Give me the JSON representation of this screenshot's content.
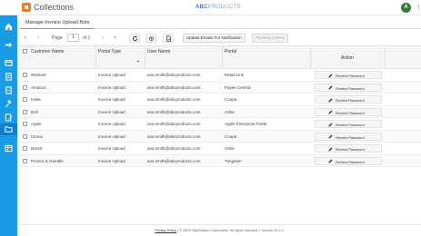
{
  "header": {
    "app_title": "Collections",
    "brand_prefix": "ABC",
    "brand_suffix": "PRODUCTS",
    "avatar_initials": "A",
    "menu_glyph": "⋮"
  },
  "sidebar": {
    "items": [
      {
        "icon": "home-icon"
      },
      {
        "icon": "arrow-right-icon"
      },
      {
        "icon": "card-icon"
      },
      {
        "icon": "document-icon"
      },
      {
        "icon": "document-icon"
      },
      {
        "icon": "gavel-icon"
      },
      {
        "icon": "edit-document-icon"
      },
      {
        "icon": "chat-icon"
      },
      {
        "icon": "folder-icon",
        "active": true
      },
      {
        "icon": "table-icon"
      }
    ]
  },
  "tab": {
    "label": "Manage Invoice Upload Bots"
  },
  "pager": {
    "page_label": "Page",
    "page_value": "1",
    "of_label": "of 1"
  },
  "toolbar": {
    "update_emails_label": "Update Emails For Notification",
    "pending_actions_label": "Pending Actions"
  },
  "grid": {
    "columns": [
      "Customer Name",
      "Portal Type",
      "User Name",
      "Portal",
      "Action"
    ],
    "action_label": "Review Password",
    "rows": [
      {
        "customer": "Walmart",
        "portal_type": "Invoice Upload",
        "user": "ana.smith@abcproducts.com",
        "portal": "Retail Link"
      },
      {
        "customer": "Amazon",
        "portal_type": "Invoice Upload",
        "user": "ana.smith@abcproducts.com",
        "portal": "Payee Central"
      },
      {
        "customer": "Insite",
        "portal_type": "Invoice Upload",
        "user": "ana.smith@abcproducts.com",
        "portal": "Coupa"
      },
      {
        "customer": "Dell",
        "portal_type": "Invoice Upload",
        "user": "ana.smith@abcproducts.com",
        "portal": "Ariba"
      },
      {
        "customer": "Apple",
        "portal_type": "Invoice Upload",
        "user": "ana.smith@abcproducts.com",
        "portal": "Apple Enterprise Portal"
      },
      {
        "customer": "Clorox",
        "portal_type": "Invoice Upload",
        "user": "ana.smith@abcproducts.com",
        "portal": "Coupa"
      },
      {
        "customer": "Bosch",
        "portal_type": "Invoice Upload",
        "user": "ana.smith@abcproducts.com",
        "portal": "Ariba"
      },
      {
        "customer": "Proctor & Gamble",
        "portal_type": "Invoice Upload",
        "user": "ana.smith@abcproducts.com",
        "portal": "Tungsten"
      }
    ]
  },
  "footer": {
    "privacy_label": "Privacy Policy",
    "copyright": " | © 2023 HighRadius Corporation. All rights reserved. | Version 25.1.0"
  },
  "colors": {
    "sidebar": "#1a9be6",
    "accent": "#ef7d22",
    "brand": "#4a74b0"
  }
}
